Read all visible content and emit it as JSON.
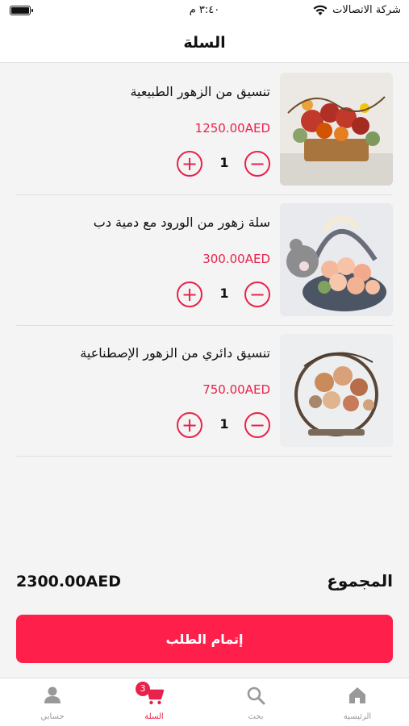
{
  "status_bar": {
    "carrier": "شركة الاتصالات",
    "time": "٣:٤٠ م"
  },
  "header": {
    "title": "السلة"
  },
  "cart": {
    "items": [
      {
        "name": "تنسيق من الزهور الطبيعية",
        "price": "1250.00AED",
        "quantity": "1",
        "plus": "+",
        "minus": "−"
      },
      {
        "name": "سلة زهور من الورود مع دمية دب",
        "price": "300.00AED",
        "quantity": "1",
        "plus": "+",
        "minus": "−"
      },
      {
        "name": "تنسيق دائري من الزهور الإصطناعية",
        "price": "750.00AED",
        "quantity": "1",
        "plus": "+",
        "minus": "−"
      }
    ],
    "total_label": "المجموع",
    "total_value": "2300.00AED",
    "checkout_label": "إتمام الطلب"
  },
  "tab_bar": {
    "active_color": "#e8224b",
    "tabs": [
      {
        "label": "الرئيسية",
        "icon": "home-icon"
      },
      {
        "label": "بحث",
        "icon": "search-icon"
      },
      {
        "label": "السلة",
        "icon": "cart-icon",
        "badge": "3",
        "active": true
      },
      {
        "label": "حسابي",
        "icon": "user-icon"
      }
    ]
  },
  "colors": {
    "accent": "#e8224b",
    "button": "#ff1f4b"
  }
}
